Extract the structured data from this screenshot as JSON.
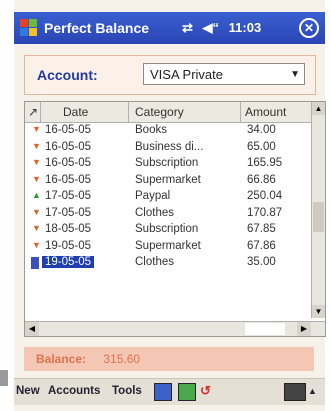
{
  "app": {
    "title": "Perfect Balance",
    "time": "11:03",
    "close_label": "ok"
  },
  "colors": {
    "title_bar": "#2f50c4",
    "accent": "#223ba4",
    "expense_marker": "#e8612c",
    "income_marker": "#2e9a3a",
    "selection": "#1f3fb0"
  },
  "account": {
    "label": "Account:",
    "value": "VISA Private"
  },
  "grid": {
    "headers": {
      "marker": "↗",
      "date": "Date",
      "category": "Category",
      "amount": "Amount"
    },
    "rows": [
      {
        "marker": "▼",
        "date": "16-05-05",
        "category": "Books",
        "amount": "34.00",
        "type": "expense"
      },
      {
        "marker": "▼",
        "date": "16-05-05",
        "category": "Business di...",
        "amount": "65.00",
        "type": "expense"
      },
      {
        "marker": "▼",
        "date": "16-05-05",
        "category": "Subscription",
        "amount": "165.95",
        "type": "expense"
      },
      {
        "marker": "▼",
        "date": "16-05-05",
        "category": "Supermarket",
        "amount": "66.86",
        "type": "expense"
      },
      {
        "marker": "▲",
        "date": "17-05-05",
        "category": "Paypal",
        "amount": "250.04",
        "type": "income"
      },
      {
        "marker": "▼",
        "date": "17-05-05",
        "category": "Clothes",
        "amount": "170.87",
        "type": "expense"
      },
      {
        "marker": "▼",
        "date": "18-05-05",
        "category": "Subscription",
        "amount": "67.85",
        "type": "expense"
      },
      {
        "marker": "▼",
        "date": "19-05-05",
        "category": "Supermarket",
        "amount": "67.86",
        "type": "expense"
      },
      {
        "marker": "",
        "date": "19-05-05",
        "category": "Clothes",
        "amount": "35.00",
        "type": "selected"
      }
    ]
  },
  "balance": {
    "label": "Balance:",
    "value": "315.60"
  },
  "menu": {
    "new": "New",
    "accounts": "Accounts",
    "tools": "Tools"
  },
  "icons": {
    "windows": "windows-logo-icon",
    "signal": "signal-icon",
    "speaker": "speaker-icon",
    "close": "close-icon"
  }
}
